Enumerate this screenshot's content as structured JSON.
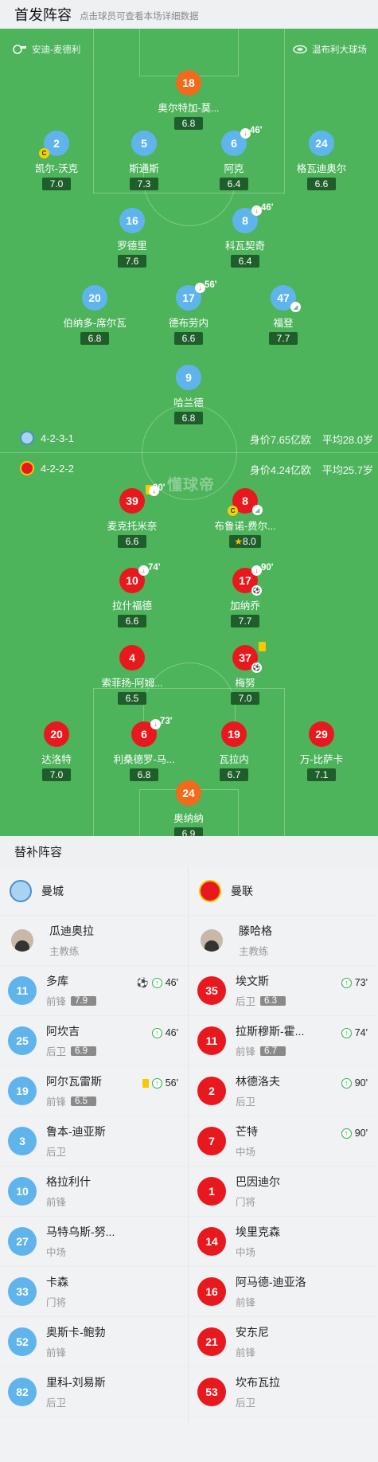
{
  "header": {
    "title": "首发阵容",
    "subtitle": "点击球员可查看本场详细数据"
  },
  "venue": {
    "home": "安迪-麦德利",
    "away": "温布利大球场"
  },
  "watermark": "懂球帝",
  "home_team": {
    "formation": "4-2-3-1",
    "value": "身价7.65亿欧",
    "age": "平均28.0岁"
  },
  "away_team": {
    "formation": "4-2-2-2",
    "value": "身价4.24亿欧",
    "age": "平均25.7岁"
  },
  "home_players": [
    {
      "num": "18",
      "name": "奥尔特加-莫...",
      "rating": "6.8"
    },
    {
      "num": "2",
      "name": "凯尔-沃克",
      "rating": "7.0"
    },
    {
      "num": "5",
      "name": "斯通斯",
      "rating": "7.3"
    },
    {
      "num": "6",
      "name": "阿克",
      "rating": "6.4",
      "sub_time": "46'"
    },
    {
      "num": "24",
      "name": "格瓦迪奥尔",
      "rating": "6.6"
    },
    {
      "num": "16",
      "name": "罗德里",
      "rating": "7.6"
    },
    {
      "num": "8",
      "name": "科瓦契奇",
      "rating": "6.4",
      "sub_time": "46'"
    },
    {
      "num": "20",
      "name": "伯纳多-席尔瓦",
      "rating": "6.8"
    },
    {
      "num": "17",
      "name": "德布劳内",
      "rating": "6.6",
      "sub_time": "56'"
    },
    {
      "num": "47",
      "name": "福登",
      "rating": "7.7"
    },
    {
      "num": "9",
      "name": "哈兰德",
      "rating": "6.8"
    }
  ],
  "away_players": [
    {
      "num": "39",
      "name": "麦克托米奈",
      "rating": "6.6",
      "sub_time": "90'"
    },
    {
      "num": "8",
      "name": "布鲁诺-费尔...",
      "rating": "8.0"
    },
    {
      "num": "10",
      "name": "拉什福德",
      "rating": "6.6",
      "sub_time": "74'"
    },
    {
      "num": "17",
      "name": "加纳乔",
      "rating": "7.7",
      "sub_time": "90'"
    },
    {
      "num": "4",
      "name": "索菲扬-阿姆...",
      "rating": "6.5"
    },
    {
      "num": "37",
      "name": "梅努",
      "rating": "7.0"
    },
    {
      "num": "20",
      "name": "达洛特",
      "rating": "7.0"
    },
    {
      "num": "6",
      "name": "利桑德罗-马...",
      "rating": "6.8",
      "sub_time": "73'"
    },
    {
      "num": "19",
      "name": "瓦拉内",
      "rating": "6.7"
    },
    {
      "num": "29",
      "name": "万-比萨卡",
      "rating": "7.1"
    },
    {
      "num": "24",
      "name": "奥纳纳",
      "rating": "6.9"
    }
  ],
  "subs": {
    "title": "替补阵容",
    "home": {
      "team": "曼城",
      "coach": {
        "name": "瓜迪奥拉",
        "role": "主教练"
      },
      "players": [
        {
          "num": "11",
          "name": "多库",
          "pos": "前锋",
          "rating": "7.9",
          "time": "46'"
        },
        {
          "num": "25",
          "name": "阿坎吉",
          "pos": "后卫",
          "rating": "6.9",
          "time": "46'"
        },
        {
          "num": "19",
          "name": "阿尔瓦雷斯",
          "pos": "前锋",
          "rating": "6.5",
          "time": "56'"
        },
        {
          "num": "3",
          "name": "鲁本-迪亚斯",
          "pos": "后卫"
        },
        {
          "num": "10",
          "name": "格拉利什",
          "pos": "前锋"
        },
        {
          "num": "27",
          "name": "马特乌斯-努...",
          "pos": "中场"
        },
        {
          "num": "33",
          "name": "卡森",
          "pos": "门将"
        },
        {
          "num": "52",
          "name": "奥斯卡-鲍勃",
          "pos": "前锋"
        },
        {
          "num": "82",
          "name": "里科-刘易斯",
          "pos": "后卫"
        }
      ]
    },
    "away": {
      "team": "曼联",
      "coach": {
        "name": "滕哈格",
        "role": "主教练"
      },
      "players": [
        {
          "num": "35",
          "name": "埃文斯",
          "pos": "后卫",
          "rating": "6.3",
          "time": "73'"
        },
        {
          "num": "11",
          "name": "拉斯穆斯-霍...",
          "pos": "前锋",
          "rating": "6.7",
          "time": "74'"
        },
        {
          "num": "2",
          "name": "林德洛夫",
          "pos": "后卫",
          "time": "90'"
        },
        {
          "num": "7",
          "name": "芒特",
          "pos": "中场",
          "time": "90'"
        },
        {
          "num": "1",
          "name": "巴因迪尔",
          "pos": "门将"
        },
        {
          "num": "14",
          "name": "埃里克森",
          "pos": "中场"
        },
        {
          "num": "16",
          "name": "阿马德-迪亚洛",
          "pos": "前锋"
        },
        {
          "num": "21",
          "name": "安东尼",
          "pos": "前锋"
        },
        {
          "num": "53",
          "name": "坎布瓦拉",
          "pos": "后卫"
        }
      ]
    }
  },
  "colors": {
    "pitch": "#4db45b",
    "city": "#60b4ec",
    "united": "#e8191e",
    "keeper": "#f26a1b"
  }
}
